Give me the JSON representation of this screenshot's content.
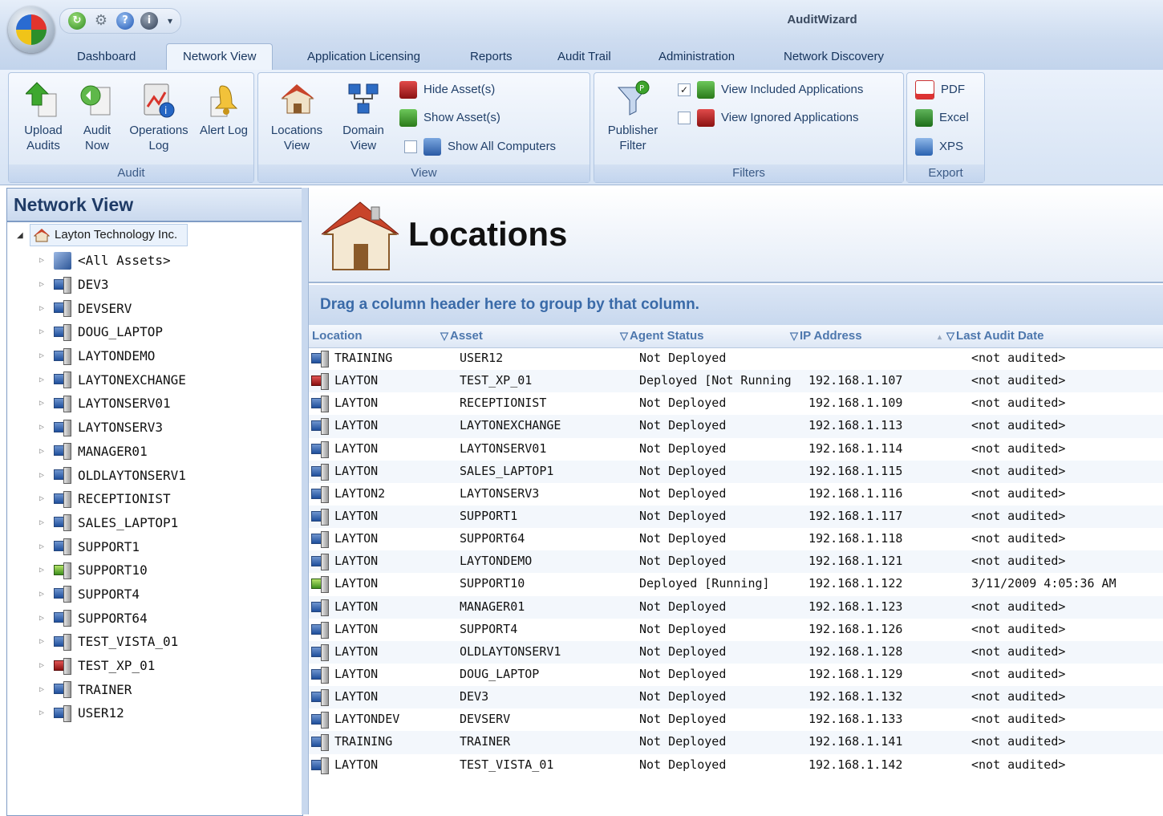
{
  "app": {
    "title": "AuditWizard"
  },
  "tabs": [
    "Dashboard",
    "Network View",
    "Application Licensing",
    "Reports",
    "Audit Trail",
    "Administration",
    "Network Discovery"
  ],
  "active_tab": "Network View",
  "ribbon": {
    "audit": {
      "label": "Audit",
      "upload": "Upload Audits",
      "audit_now": "Audit Now",
      "operations_log": "Operations Log",
      "alert_log": "Alert Log"
    },
    "view": {
      "label": "View",
      "locations": "Locations View",
      "domain": "Domain View",
      "hide": "Hide Asset(s)",
      "show": "Show Asset(s)",
      "show_all": "Show All Computers"
    },
    "filters": {
      "label": "Filters",
      "publisher": "Publisher Filter",
      "view_included": "View Included Applications",
      "view_ignored": "View Ignored Applications"
    },
    "export": {
      "label": "Export",
      "pdf": "PDF",
      "excel": "Excel",
      "xps": "XPS"
    }
  },
  "left_panel": {
    "title": "Network View",
    "root": "Layton Technology Inc.",
    "nodes": [
      {
        "label": "<All Assets>",
        "icon": "all"
      },
      {
        "label": "DEV3",
        "icon": "pc"
      },
      {
        "label": "DEVSERV",
        "icon": "pc"
      },
      {
        "label": "DOUG_LAPTOP",
        "icon": "pc"
      },
      {
        "label": "LAYTONDEMO",
        "icon": "pc"
      },
      {
        "label": "LAYTONEXCHANGE",
        "icon": "pc"
      },
      {
        "label": "LAYTONSERV01",
        "icon": "pc"
      },
      {
        "label": "LAYTONSERV3",
        "icon": "pc"
      },
      {
        "label": "MANAGER01",
        "icon": "pc"
      },
      {
        "label": "OLDLAYTONSERV1",
        "icon": "pc"
      },
      {
        "label": "RECEPTIONIST",
        "icon": "pc"
      },
      {
        "label": "SALES_LAPTOP1",
        "icon": "pc"
      },
      {
        "label": "SUPPORT1",
        "icon": "pc"
      },
      {
        "label": "SUPPORT10",
        "icon": "green"
      },
      {
        "label": "SUPPORT4",
        "icon": "pc"
      },
      {
        "label": "SUPPORT64",
        "icon": "pc"
      },
      {
        "label": "TEST_VISTA_01",
        "icon": "pc"
      },
      {
        "label": "TEST_XP_01",
        "icon": "red"
      },
      {
        "label": "TRAINER",
        "icon": "pc"
      },
      {
        "label": "USER12",
        "icon": "pc"
      }
    ]
  },
  "main": {
    "title": "Locations",
    "group_hint": "Drag a column header here to group by that column.",
    "columns": [
      "Location",
      "Asset",
      "Agent Status",
      "IP Address",
      "Last Audit Date"
    ],
    "rows": [
      {
        "icon": "pc",
        "location": "TRAINING",
        "asset": "USER12",
        "status": "Not Deployed",
        "ip": "",
        "date": "<not audited>"
      },
      {
        "icon": "red",
        "location": "LAYTON",
        "asset": "TEST_XP_01",
        "status": "Deployed [Not Running",
        "ip": "192.168.1.107",
        "date": "<not audited>"
      },
      {
        "icon": "pc",
        "location": "LAYTON",
        "asset": "RECEPTIONIST",
        "status": "Not Deployed",
        "ip": "192.168.1.109",
        "date": "<not audited>"
      },
      {
        "icon": "pc",
        "location": "LAYTON",
        "asset": "LAYTONEXCHANGE",
        "status": "Not Deployed",
        "ip": "192.168.1.113",
        "date": "<not audited>"
      },
      {
        "icon": "pc",
        "location": "LAYTON",
        "asset": "LAYTONSERV01",
        "status": "Not Deployed",
        "ip": "192.168.1.114",
        "date": "<not audited>"
      },
      {
        "icon": "pc",
        "location": "LAYTON",
        "asset": "SALES_LAPTOP1",
        "status": "Not Deployed",
        "ip": "192.168.1.115",
        "date": "<not audited>"
      },
      {
        "icon": "pc",
        "location": "LAYTON2",
        "asset": "LAYTONSERV3",
        "status": "Not Deployed",
        "ip": "192.168.1.116",
        "date": "<not audited>"
      },
      {
        "icon": "pc",
        "location": "LAYTON",
        "asset": "SUPPORT1",
        "status": "Not Deployed",
        "ip": "192.168.1.117",
        "date": "<not audited>"
      },
      {
        "icon": "pc",
        "location": "LAYTON",
        "asset": "SUPPORT64",
        "status": "Not Deployed",
        "ip": "192.168.1.118",
        "date": "<not audited>"
      },
      {
        "icon": "pc",
        "location": "LAYTON",
        "asset": "LAYTONDEMO",
        "status": "Not Deployed",
        "ip": "192.168.1.121",
        "date": "<not audited>"
      },
      {
        "icon": "green",
        "location": "LAYTON",
        "asset": "SUPPORT10",
        "status": "Deployed [Running]",
        "ip": "192.168.1.122",
        "date": "3/11/2009 4:05:36 AM"
      },
      {
        "icon": "pc",
        "location": "LAYTON",
        "asset": "MANAGER01",
        "status": "Not Deployed",
        "ip": "192.168.1.123",
        "date": "<not audited>"
      },
      {
        "icon": "pc",
        "location": "LAYTON",
        "asset": "SUPPORT4",
        "status": "Not Deployed",
        "ip": "192.168.1.126",
        "date": "<not audited>"
      },
      {
        "icon": "pc",
        "location": "LAYTON",
        "asset": "OLDLAYTONSERV1",
        "status": "Not Deployed",
        "ip": "192.168.1.128",
        "date": "<not audited>"
      },
      {
        "icon": "pc",
        "location": "LAYTON",
        "asset": "DOUG_LAPTOP",
        "status": "Not Deployed",
        "ip": "192.168.1.129",
        "date": "<not audited>"
      },
      {
        "icon": "pc",
        "location": "LAYTON",
        "asset": "DEV3",
        "status": "Not Deployed",
        "ip": "192.168.1.132",
        "date": "<not audited>"
      },
      {
        "icon": "pc",
        "location": "LAYTONDEV",
        "asset": "DEVSERV",
        "status": "Not Deployed",
        "ip": "192.168.1.133",
        "date": "<not audited>"
      },
      {
        "icon": "pc",
        "location": "TRAINING",
        "asset": "TRAINER",
        "status": "Not Deployed",
        "ip": "192.168.1.141",
        "date": "<not audited>"
      },
      {
        "icon": "pc",
        "location": "LAYTON",
        "asset": "TEST_VISTA_01",
        "status": "Not Deployed",
        "ip": "192.168.1.142",
        "date": "<not audited>"
      }
    ]
  }
}
